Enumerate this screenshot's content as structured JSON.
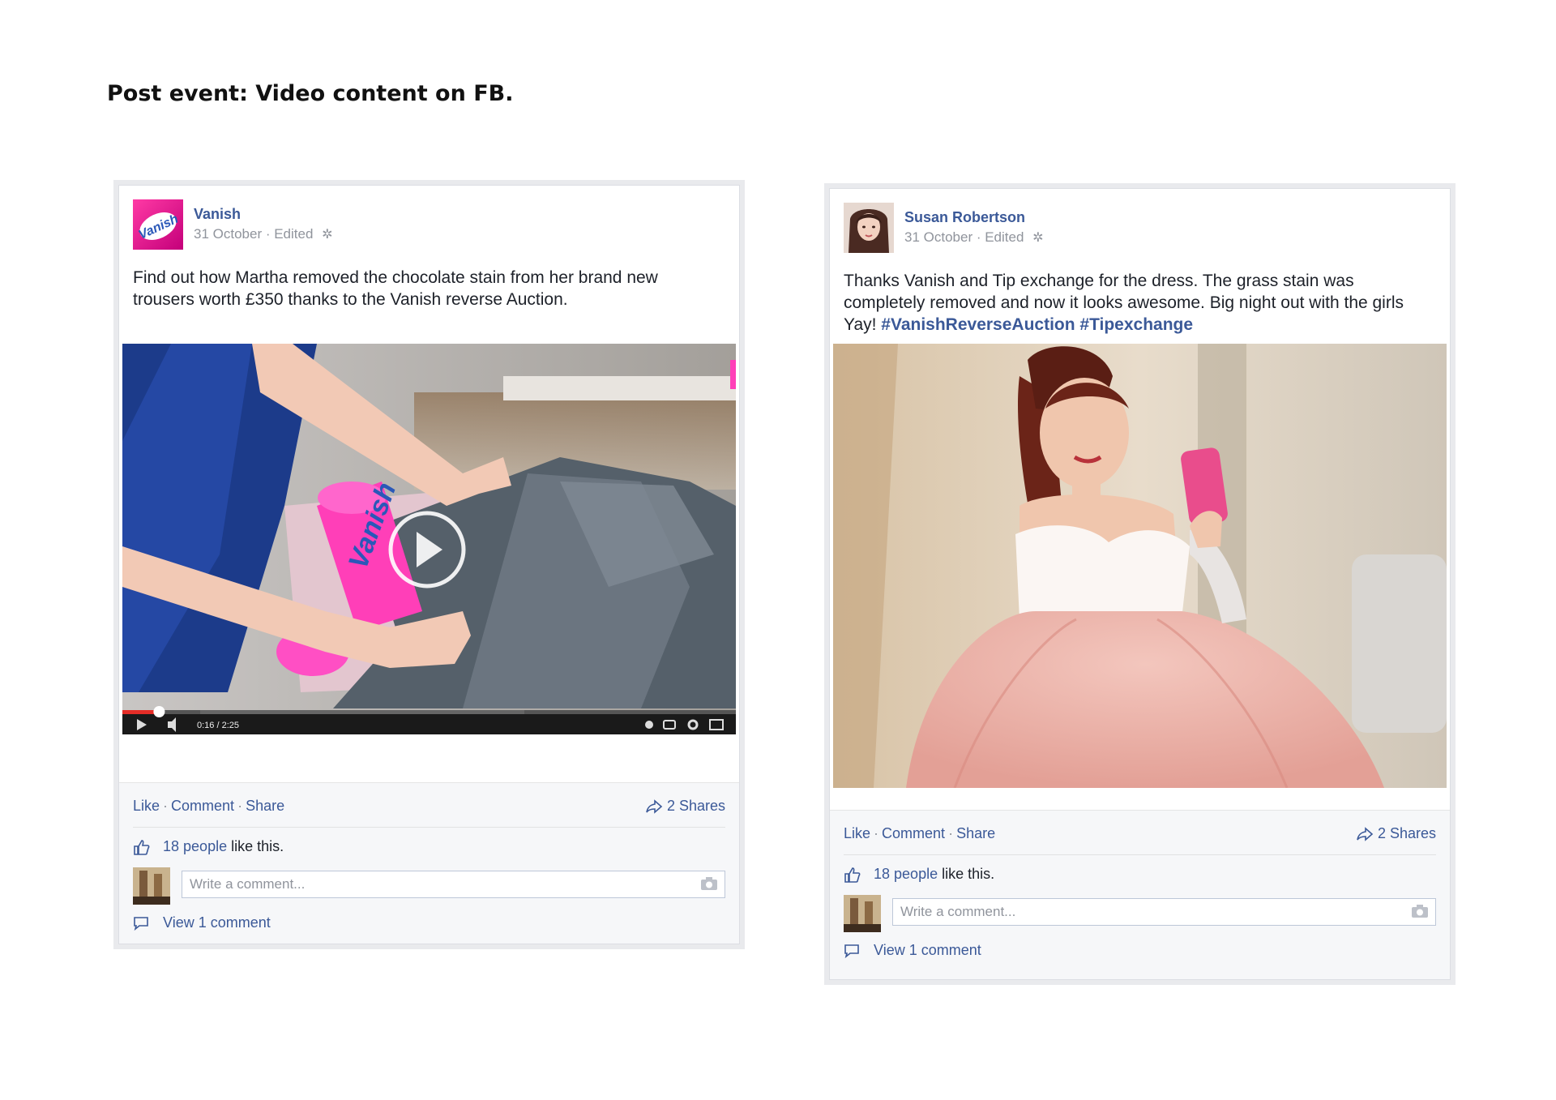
{
  "page": {
    "heading": "Post event: Video content on FB."
  },
  "posts": [
    {
      "author": "Vanish",
      "meta": "31 October · Edited",
      "text": "Find out how Martha removed the chocolate stain from her brand new trousers worth £350 thanks to the Vanish reverse Auction.",
      "media_type": "video",
      "video": {
        "time": "0:16 / 2:25",
        "progress": 0.06
      },
      "actions": {
        "like": "Like",
        "comment": "Comment",
        "share": "Share"
      },
      "shares": "2 Shares",
      "likes": {
        "count": "18 people",
        "suffix": " like this."
      },
      "comment_placeholder": "Write a comment...",
      "view_comments": "View 1 comment"
    },
    {
      "author": "Susan Robertson",
      "meta": "31 October · Edited",
      "text_plain": "Thanks Vanish and Tip exchange for the dress. The grass stain was completely removed and now it looks awesome. Big night out with the girls Yay! ",
      "hashtags": "#VanishReverseAuction #Tipexchange",
      "media_type": "photo",
      "actions": {
        "like": "Like",
        "comment": "Comment",
        "share": "Share"
      },
      "shares": "2 Shares",
      "likes": {
        "count": "18 people",
        "suffix": " like this."
      },
      "comment_placeholder": "Write a comment...",
      "view_comments": "View 1 comment"
    }
  ],
  "icons": [
    "settings-gear-icon",
    "share-arrow-icon",
    "thumbs-up-icon",
    "camera-icon",
    "comment-bubble-icon",
    "play-icon",
    "volume-icon",
    "cc-icon",
    "fullscreen-icon"
  ]
}
